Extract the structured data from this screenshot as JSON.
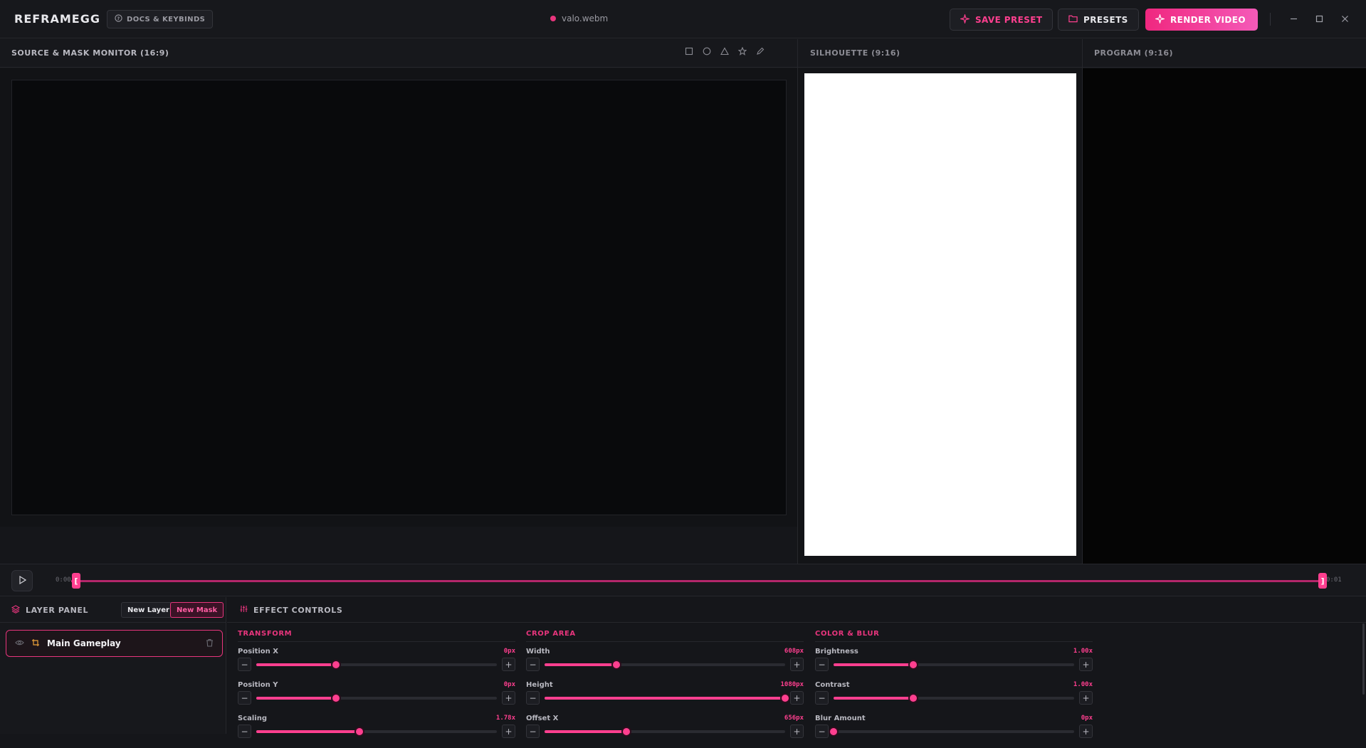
{
  "app": {
    "name": "REFRAMEGG",
    "docs_label": "DOCS & KEYBINDS",
    "file_name": "valo.webm"
  },
  "header": {
    "save_preset": "SAVE PRESET",
    "presets": "PRESETS",
    "render_video": "RENDER VIDEO"
  },
  "panels": {
    "source_title": "SOURCE & MASK MONITOR (16:9)",
    "silhouette_title": "SILHOUETTE (9:16)",
    "program_title": "PROGRAM (9:16)",
    "mask_tools": [
      "rectangle-icon",
      "circle-icon",
      "triangle-icon",
      "star-icon",
      "pen-icon"
    ]
  },
  "timeline": {
    "start": "0:00",
    "end": "0:01",
    "progress": 0
  },
  "layers": {
    "title": "LAYER PANEL",
    "new_layer": "New Layer",
    "new_mask": "New Mask",
    "items": [
      {
        "name": "Main Gameplay"
      }
    ]
  },
  "effects": {
    "title": "EFFECT CONTROLS",
    "transform": {
      "title": "TRANSFORM",
      "controls": [
        {
          "label": "Position X",
          "value": "0px",
          "level": 0.33
        },
        {
          "label": "Position Y",
          "value": "0px",
          "level": 0.33
        },
        {
          "label": "Scaling",
          "value": "1.78x",
          "level": 0.43
        }
      ]
    },
    "crop": {
      "title": "CROP AREA",
      "controls": [
        {
          "label": "Width",
          "value": "608px",
          "level": 0.3
        },
        {
          "label": "Height",
          "value": "1080px",
          "level": 1.0
        },
        {
          "label": "Offset X",
          "value": "656px",
          "level": 0.34
        }
      ]
    },
    "color": {
      "title": "COLOR & BLUR",
      "controls": [
        {
          "label": "Brightness",
          "value": "1.00x",
          "level": 0.33
        },
        {
          "label": "Contrast",
          "value": "1.00x",
          "level": 0.33
        },
        {
          "label": "Blur Amount",
          "value": "0px",
          "level": 0.0
        }
      ]
    }
  },
  "colors": {
    "accent": "#ff3f8f",
    "background": "#15161a"
  }
}
